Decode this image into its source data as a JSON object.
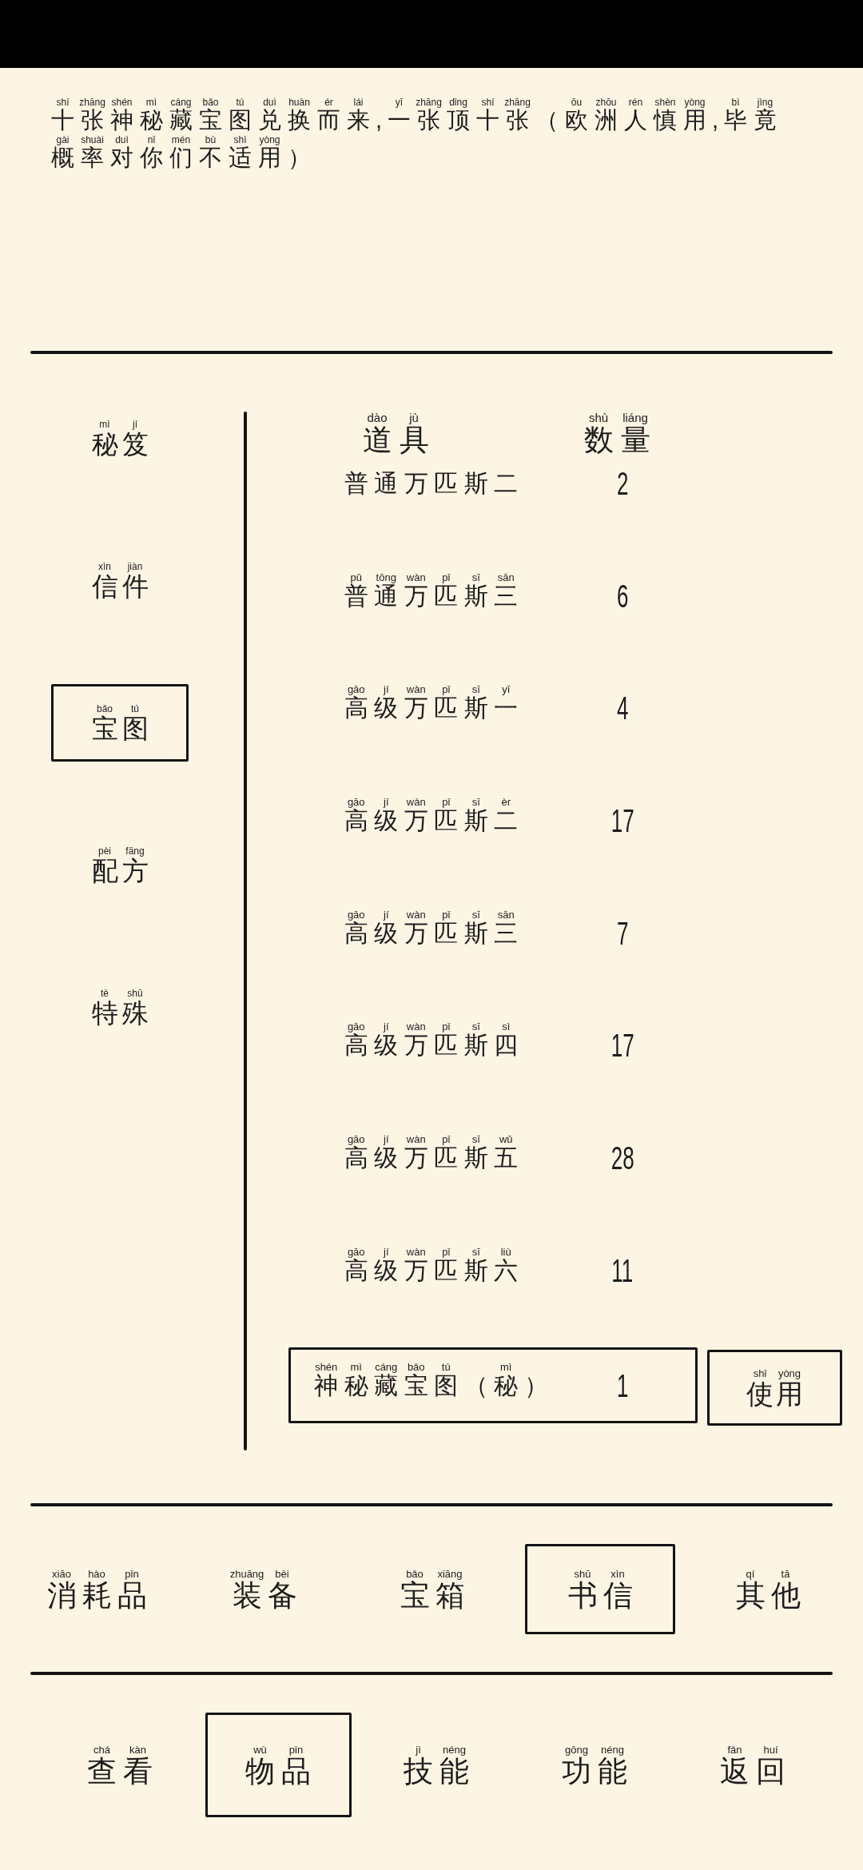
{
  "description": {
    "lines": [
      {
        "text": "十张神秘藏宝图兑换而来,一张顶十张（欧洲人慎用,毕竟",
        "pinyin": "shí zhāng shén mì cáng bǎo tú duì huàn ér lái yī zhāng dǐng shí zhāng ōu zhōu rén shèn yòng bì jìng"
      },
      {
        "text": "概率对你们不适用）",
        "pinyin": "gài shuài duì nǐ mén bù shì yòng"
      }
    ]
  },
  "categories": [
    {
      "text": "秘笈",
      "pinyin": "mì jí",
      "selected": false
    },
    {
      "text": "信件",
      "pinyin": "xìn jiàn",
      "selected": false
    },
    {
      "text": "宝图",
      "pinyin": "bǎo tú",
      "selected": true
    },
    {
      "text": "配方",
      "pinyin": "pèi fāng",
      "selected": false
    },
    {
      "text": "特殊",
      "pinyin": "tè shū",
      "selected": false
    }
  ],
  "table": {
    "columns": [
      {
        "text": "道具",
        "pinyin": "dào jù"
      },
      {
        "text": "数量",
        "pinyin": "shù liáng"
      }
    ],
    "rows": [
      {
        "name": "普通万匹斯二",
        "count": "2",
        "selected": false
      },
      {
        "name": "普通万匹斯三",
        "pinyin": "pǔ tōng wàn pǐ sī sān",
        "count": "6",
        "selected": false
      },
      {
        "name": "高级万匹斯一",
        "pinyin": "gāo jí wàn pǐ sī yī",
        "count": "4",
        "selected": false
      },
      {
        "name": "高级万匹斯二",
        "pinyin": "gāo jí wàn pǐ sī èr",
        "count": "17",
        "selected": false
      },
      {
        "name": "高级万匹斯三",
        "pinyin": "gāo jí wàn pǐ sī sān",
        "count": "7",
        "selected": false
      },
      {
        "name": "高级万匹斯四",
        "pinyin": "gāo jí wàn pǐ sī sì",
        "count": "17",
        "selected": false
      },
      {
        "name": "高级万匹斯五",
        "pinyin": "gāo jí wàn pǐ sī wǔ",
        "count": "28",
        "selected": false
      },
      {
        "name": "高级万匹斯六",
        "pinyin": "gāo jí wàn pǐ sī liù",
        "count": "11",
        "selected": false
      },
      {
        "name": "神秘藏宝图（秘）",
        "pinyin": "shén mì cáng bǎo tú mì",
        "count": "1",
        "selected": true
      }
    ],
    "use_button": {
      "text": "使用",
      "pinyin": "shǐ yòng"
    }
  },
  "item_tabs": [
    {
      "text": "消耗品",
      "pinyin": "xiāo hào pǐn",
      "selected": false
    },
    {
      "text": "装备",
      "pinyin": "zhuāng bèi",
      "selected": false
    },
    {
      "text": "宝箱",
      "pinyin": "bǎo xiāng",
      "selected": false
    },
    {
      "text": "书信",
      "pinyin": "shū xìn",
      "selected": true
    },
    {
      "text": "其他",
      "pinyin": "qí tā",
      "selected": false
    }
  ],
  "main_tabs": [
    {
      "text": "查看",
      "pinyin": "chá kàn",
      "selected": false
    },
    {
      "text": "物品",
      "pinyin": "wù pǐn",
      "selected": true
    },
    {
      "text": "技能",
      "pinyin": "jì néng",
      "selected": false
    },
    {
      "text": "功能",
      "pinyin": "gōng néng",
      "selected": false
    },
    {
      "text": "返回",
      "pinyin": "fǎn huí",
      "selected": false
    }
  ]
}
